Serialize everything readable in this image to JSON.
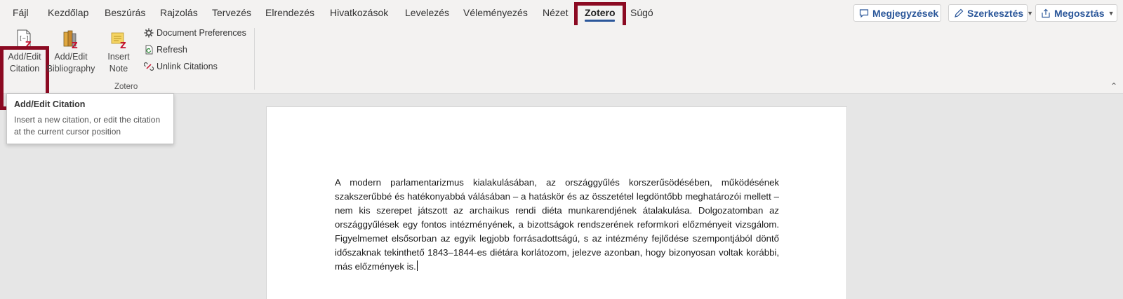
{
  "menu": {
    "tabs": [
      "Fájl",
      "Kezdőlap",
      "Beszúrás",
      "Rajzolás",
      "Tervezés",
      "Elrendezés",
      "Hivatkozások",
      "Levelezés",
      "Véleményezés",
      "Nézet",
      "Zotero",
      "Súgó"
    ],
    "active_tab": "Zotero",
    "comments_label": "Megjegyzések",
    "editing_label": "Szerkesztés",
    "share_label": "Megosztás"
  },
  "ribbon": {
    "add_edit_citation": {
      "line1": "Add/Edit",
      "line2": "Citation"
    },
    "add_edit_bibliography": {
      "line1": "Add/Edit",
      "line2": "Bibliography"
    },
    "insert_note": {
      "line1": "Insert",
      "line2": "Note"
    },
    "document_preferences": "Document Preferences",
    "refresh": "Refresh",
    "unlink_citations": "Unlink Citations",
    "group_label": "Zotero"
  },
  "tooltip": {
    "title": "Add/Edit Citation",
    "description": "Insert a new citation, or edit the citation at the current cursor position"
  },
  "document": {
    "paragraph": "A modern parlamentarizmus kialakulásában, az országgyűlés korszerűsödésében, működésének szakszerűbbé és hatékonyabbá válásában – a hatáskör és az összetétel legdöntőbb meghatározói mellett – nem kis szerepet játszott az archaikus rendi diéta munkarendjének átalakulása. Dolgozatomban az országgyűlések egy fontos intézményének, a bizottságok rendszerének reformkori előzményeit vizsgálom. Figyelmemet elsősorban az egyik legjobb forrásadottságú, s az intézmény fejlődése szempontjából döntő időszaknak tekinthető 1843–1844-es diétára korlátozom, jelezve azonban, hogy bizonyosan voltak korábbi, más előzmények is."
  },
  "colors": {
    "highlight": "#8b0a22",
    "accent": "#2b579a",
    "zotero_red": "#c4122f"
  }
}
